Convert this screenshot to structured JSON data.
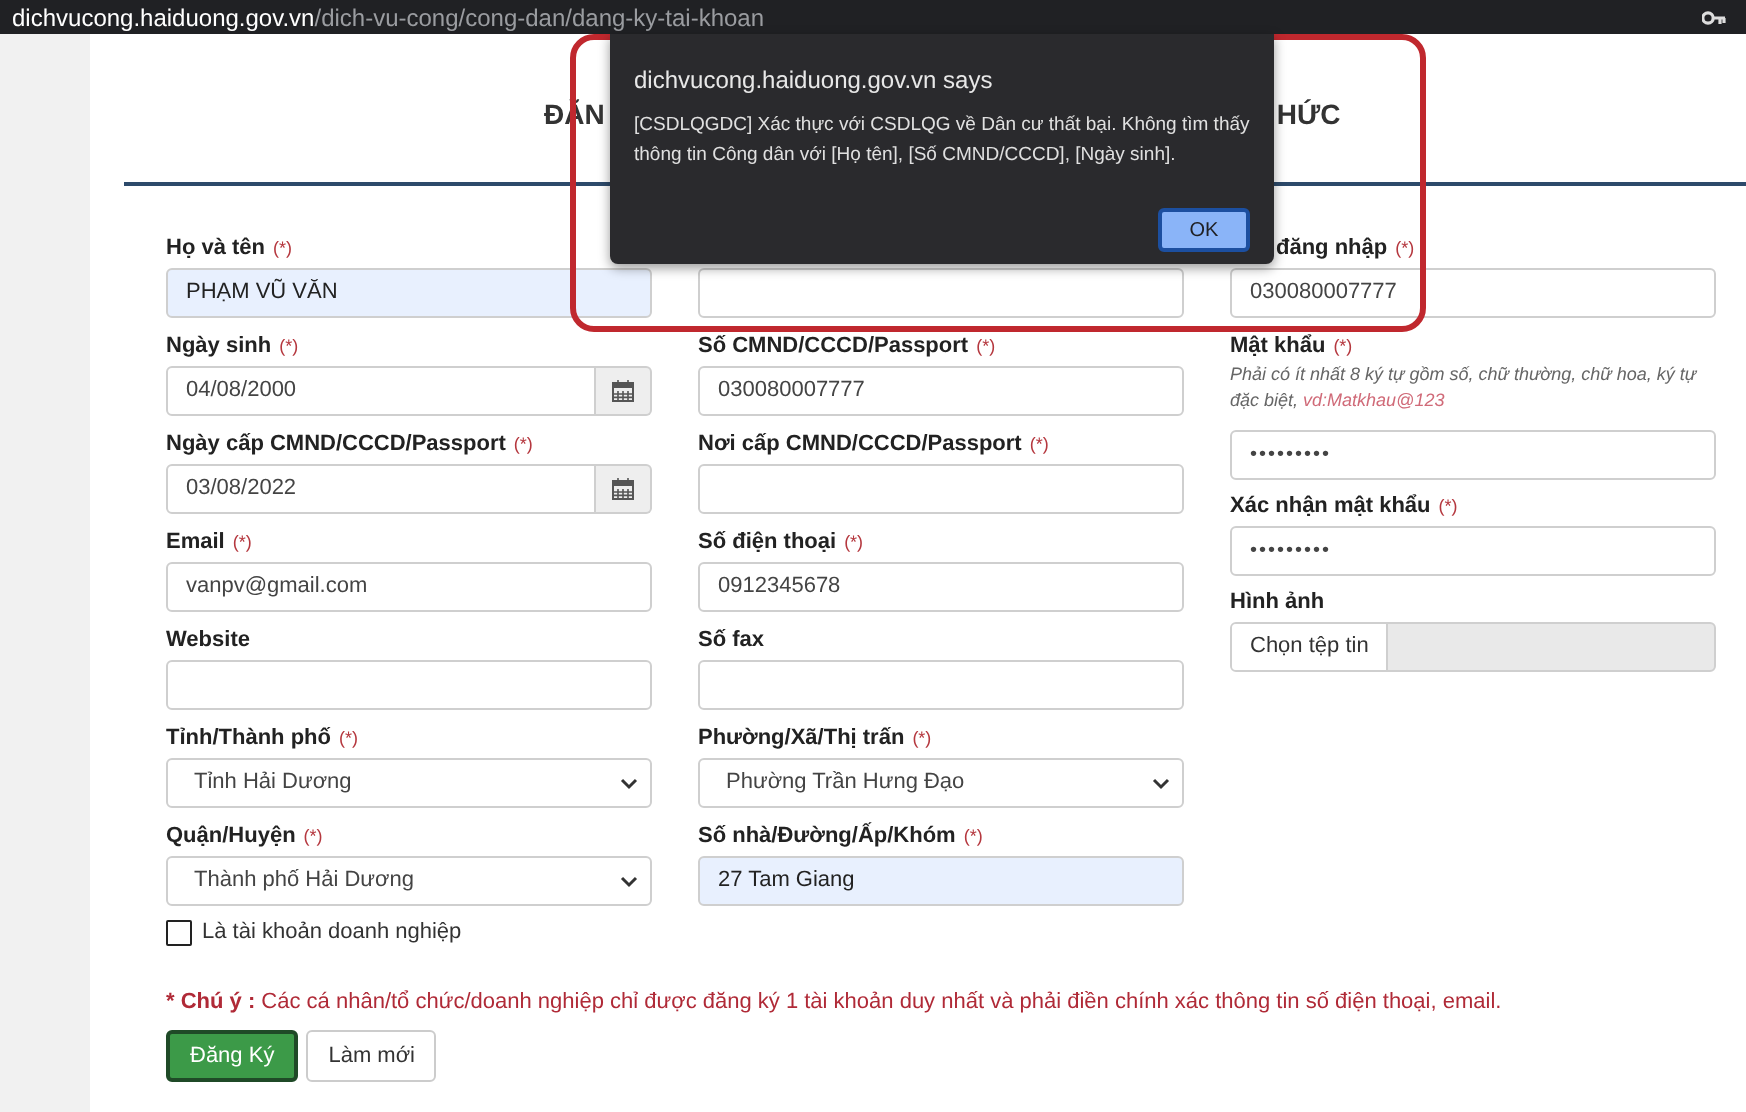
{
  "address_bar": {
    "host": "dichvucong.haiduong.gov.vn",
    "path": "/dich-vu-cong/cong-dan/dang-ky-tai-khoan"
  },
  "title_parts": [
    "ĐĂN",
    "HỨC"
  ],
  "columns": [
    {
      "fields": [
        {
          "kind": "text",
          "label": "Họ và tên",
          "required_mark": "(*)",
          "value": "PHẠM VŨ VĂN",
          "highlighted": true
        },
        {
          "kind": "date",
          "label": "Ngày sinh",
          "required_mark": "(*)",
          "value": "04/08/2000",
          "highlighted": false
        },
        {
          "kind": "date",
          "label": "Ngày cấp CMND/CCCD/Passport",
          "required_mark": "(*)",
          "value": "03/08/2022",
          "highlighted": false
        },
        {
          "kind": "text",
          "label": "Email",
          "required_mark": "(*)",
          "value": "vanpv@gmail.com",
          "highlighted": false
        },
        {
          "kind": "text",
          "label": "Website",
          "highlighted": false
        },
        {
          "kind": "select",
          "label": "Tỉnh/Thành phố",
          "required_mark": "(*)",
          "value": "Tỉnh Hải Dương",
          "highlighted": false
        },
        {
          "kind": "select",
          "label": "Quận/Huyện",
          "required_mark": "(*)",
          "value": "Thành phố Hải Dương",
          "highlighted": false
        }
      ]
    },
    {
      "fields": [
        {
          "kind": "text",
          "highlighted": false
        },
        {
          "kind": "text",
          "label": "Số CMND/CCCD/Passport",
          "required_mark": "(*)",
          "value": "030080007777",
          "highlighted": false
        },
        {
          "kind": "text",
          "label": "Nơi cấp CMND/CCCD/Passport",
          "required_mark": "(*)",
          "highlighted": false
        },
        {
          "kind": "text",
          "label": "Số điện thoại",
          "required_mark": "(*)",
          "value": "0912345678",
          "highlighted": false
        },
        {
          "kind": "text",
          "label": "Số fax",
          "highlighted": false
        },
        {
          "kind": "select",
          "label": "Phường/Xã/Thị trấn",
          "required_mark": "(*)",
          "value": "Phường Trần Hưng Đạo",
          "highlighted": false
        },
        {
          "kind": "text",
          "label": "Số nhà/Đường/Ấp/Khóm",
          "required_mark": "(*)",
          "value": "27 Tam Giang",
          "highlighted": true
        }
      ]
    },
    {
      "fields": [
        {
          "kind": "text",
          "label": "đăng nhập",
          "required_mark": "(*)",
          "value": "030080007777",
          "highlighted": false
        },
        {
          "kind": "password",
          "label": "Mật khẩu",
          "required_mark": "(*)",
          "hint": "Phải có ít nhất 8 ký tự gồm số, chữ thường, chữ hoa, ký tự đặc biệt,",
          "hint_example": "vd:Matkhau@123",
          "value": "•••••••••",
          "highlighted": false
        },
        {
          "kind": "password",
          "label": "Xác nhận mật khẩu",
          "required_mark": "(*)",
          "value": "•••••••••",
          "highlighted": false
        },
        {
          "kind": "file",
          "label": "Hình ảnh",
          "button_label": "Chọn tệp tin"
        }
      ]
    }
  ],
  "business_checkbox": {
    "label": "Là tài khoản doanh nghiệp",
    "checked": false
  },
  "note": {
    "lead": "* Chú ý :",
    "text": "Các cá nhân/tổ chức/doanh nghiệp chỉ được đăng ký 1 tài khoản duy nhất và phải điền chính xác thông tin số điện thoại, email."
  },
  "buttons": [
    {
      "kind": "primary",
      "label": "Đăng Ký"
    },
    {
      "kind": "default",
      "label": "Làm mới"
    }
  ],
  "dialog": {
    "title": "dichvucong.haiduong.gov.vn says",
    "message": "[CSDLQGDC] Xác thực với CSDLQG về Dân cư thất bại. Không tìm thấy thông tin Công dân với [Họ tên], [Số CMND/CCCD], [Ngày sinh].",
    "ok_label": "OK"
  }
}
